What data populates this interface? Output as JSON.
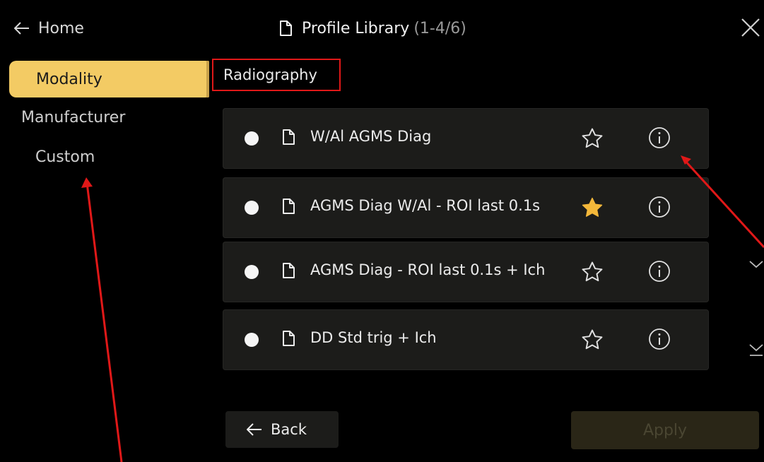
{
  "header": {
    "home_label": "Home",
    "title": "Profile Library",
    "count": "(1-4/6)"
  },
  "sidebar": {
    "items": [
      {
        "label": "Modality",
        "active": true
      },
      {
        "label": "Manufacturer",
        "active": false
      },
      {
        "label": "Custom",
        "active": false
      }
    ]
  },
  "category": "Radiography",
  "profiles": [
    {
      "name": "W/Al AGMS Diag",
      "favorite": false
    },
    {
      "name": "AGMS Diag W/Al - ROI last 0.1s",
      "favorite": true
    },
    {
      "name": "AGMS Diag - ROI last 0.1s + Ich",
      "favorite": false
    },
    {
      "name": "DD Std trig + Ich",
      "favorite": false
    }
  ],
  "footer": {
    "back_label": "Back",
    "apply_label": "Apply"
  },
  "colors": {
    "accent": "#f3cb64",
    "annotation": "#e01818",
    "row_bg": "#1c1c1a"
  }
}
